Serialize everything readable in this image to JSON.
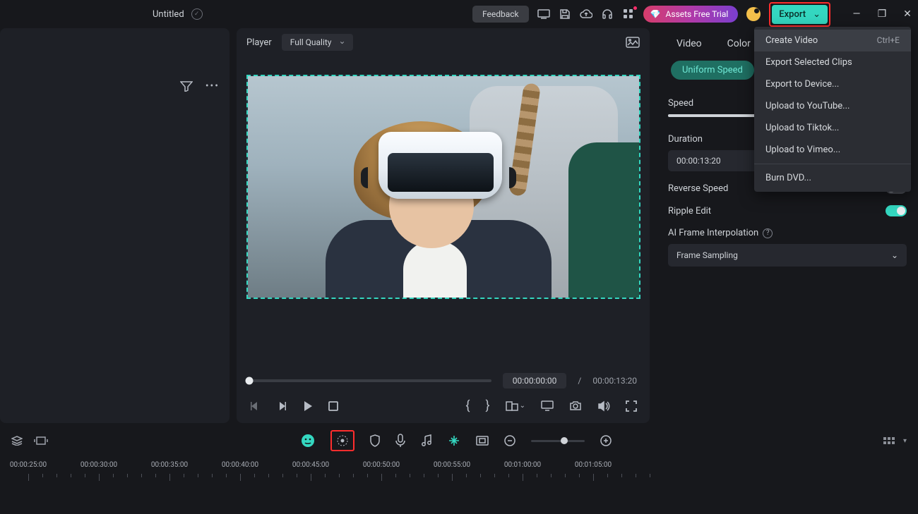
{
  "titlebar": {
    "title": "Untitled",
    "feedback": "Feedback",
    "assets_trial": "Assets Free Trial",
    "export": "Export"
  },
  "export_menu": {
    "items": [
      {
        "label": "Create Video",
        "shortcut": "Ctrl+E",
        "selected": true
      },
      {
        "label": "Export Selected Clips"
      },
      {
        "label": "Export to Device..."
      },
      {
        "label": "Upload to YouTube..."
      },
      {
        "label": "Upload to Tiktok..."
      },
      {
        "label": "Upload to Vimeo..."
      }
    ],
    "burn": "Burn DVD..."
  },
  "preview": {
    "player_label": "Player",
    "quality": "Full Quality",
    "current_time": "00:00:00:00",
    "time_sep": "/",
    "total_time": "00:00:13:20"
  },
  "inspector": {
    "tab_video": "Video",
    "tab_color": "Color",
    "pill": "Uniform Speed",
    "speed_label": "Speed",
    "duration_label": "Duration",
    "duration_value": "00:00:13:20",
    "reverse_label": "Reverse Speed",
    "ripple_label": "Ripple Edit",
    "ai_label": "AI Frame Interpolation",
    "ai_mode": "Frame Sampling"
  },
  "timeline": {
    "labels": [
      "00:00:25:00",
      "00:00:30:00",
      "00:00:35:00",
      "00:00:40:00",
      "00:00:45:00",
      "00:00:50:00",
      "00:00:55:00",
      "00:01:00:00",
      "00:01:05:00"
    ]
  }
}
